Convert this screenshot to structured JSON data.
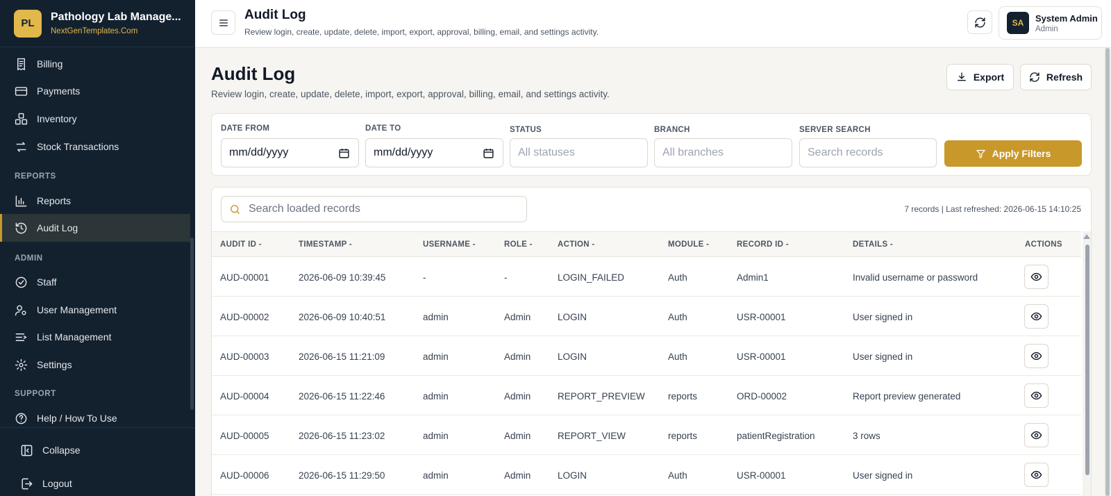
{
  "brand": {
    "logo": "PL",
    "title": "Pathology Lab Manage...",
    "subtitle": "NextGenTemplates.Com"
  },
  "sidebar": {
    "items": [
      {
        "label": "Billing",
        "icon": "receipt-icon"
      },
      {
        "label": "Payments",
        "icon": "credit-card-icon"
      },
      {
        "label": "Inventory",
        "icon": "boxes-icon"
      },
      {
        "label": "Stock Transactions",
        "icon": "swap-arrows-icon"
      }
    ],
    "reports_section": "REPORTS",
    "reports_items": [
      {
        "label": "Reports",
        "icon": "bar-chart-icon"
      },
      {
        "label": "Audit Log",
        "icon": "history-icon",
        "active": true
      }
    ],
    "admin_section": "ADMIN",
    "admin_items": [
      {
        "label": "Staff",
        "icon": "check-circle-icon"
      },
      {
        "label": "User Management",
        "icon": "user-cog-icon"
      },
      {
        "label": "List Management",
        "icon": "list-icon"
      },
      {
        "label": "Settings",
        "icon": "gear-icon"
      }
    ],
    "support_section": "SUPPORT",
    "support_items": [
      {
        "label": "Help / How To Use",
        "icon": "help-circle-icon"
      }
    ],
    "collapse_label": "Collapse",
    "logout_label": "Logout"
  },
  "header": {
    "title": "Audit Log",
    "subtitle": "Review login, create, update, delete, import, export, approval, billing, email, and settings activity.",
    "user": {
      "initials": "SA",
      "name": "System Admin",
      "role": "Admin"
    }
  },
  "page": {
    "title": "Audit Log",
    "subtitle": "Review login, create, update, delete, import, export, approval, billing, email, and settings activity.",
    "export_label": "Export",
    "refresh_label": "Refresh"
  },
  "filters": {
    "date_from_label": "DATE FROM",
    "date_from_value": "mm/dd/yyyy",
    "date_to_label": "DATE TO",
    "date_to_value": "mm/dd/yyyy",
    "status_label": "STATUS",
    "status_value": "All statuses",
    "branch_label": "BRANCH",
    "branch_value": "All branches",
    "search_label": "SERVER SEARCH",
    "search_placeholder": "Search records",
    "apply_label": "Apply Filters"
  },
  "table": {
    "search_placeholder": "Search loaded records",
    "record_info": "7 records | Last refreshed: 2026-06-15 14:10:25",
    "columns": [
      "AUDIT ID -",
      "TIMESTAMP -",
      "USERNAME -",
      "ROLE -",
      "ACTION -",
      "MODULE -",
      "RECORD ID -",
      "DETAILS -",
      "ACTIONS"
    ],
    "rows": [
      [
        "AUD-00001",
        "2026-06-09 10:39:45",
        "-",
        "-",
        "LOGIN_FAILED",
        "Auth",
        "Admin1",
        "Invalid username or password"
      ],
      [
        "AUD-00002",
        "2026-06-09 10:40:51",
        "admin",
        "Admin",
        "LOGIN",
        "Auth",
        "USR-00001",
        "User signed in"
      ],
      [
        "AUD-00003",
        "2026-06-15 11:21:09",
        "admin",
        "Admin",
        "LOGIN",
        "Auth",
        "USR-00001",
        "User signed in"
      ],
      [
        "AUD-00004",
        "2026-06-15 11:22:46",
        "admin",
        "Admin",
        "REPORT_PREVIEW",
        "reports",
        "ORD-00002",
        "Report preview generated"
      ],
      [
        "AUD-00005",
        "2026-06-15 11:23:02",
        "admin",
        "Admin",
        "REPORT_VIEW",
        "reports",
        "patientRegistration",
        "3 rows"
      ],
      [
        "AUD-00006",
        "2026-06-15 11:29:50",
        "admin",
        "Admin",
        "LOGIN",
        "Auth",
        "USR-00001",
        "User signed in"
      ]
    ]
  },
  "colors": {
    "sidebar_bg": "#13212f",
    "accent": "#c9982a",
    "brand_gold": "#e2b84a"
  }
}
